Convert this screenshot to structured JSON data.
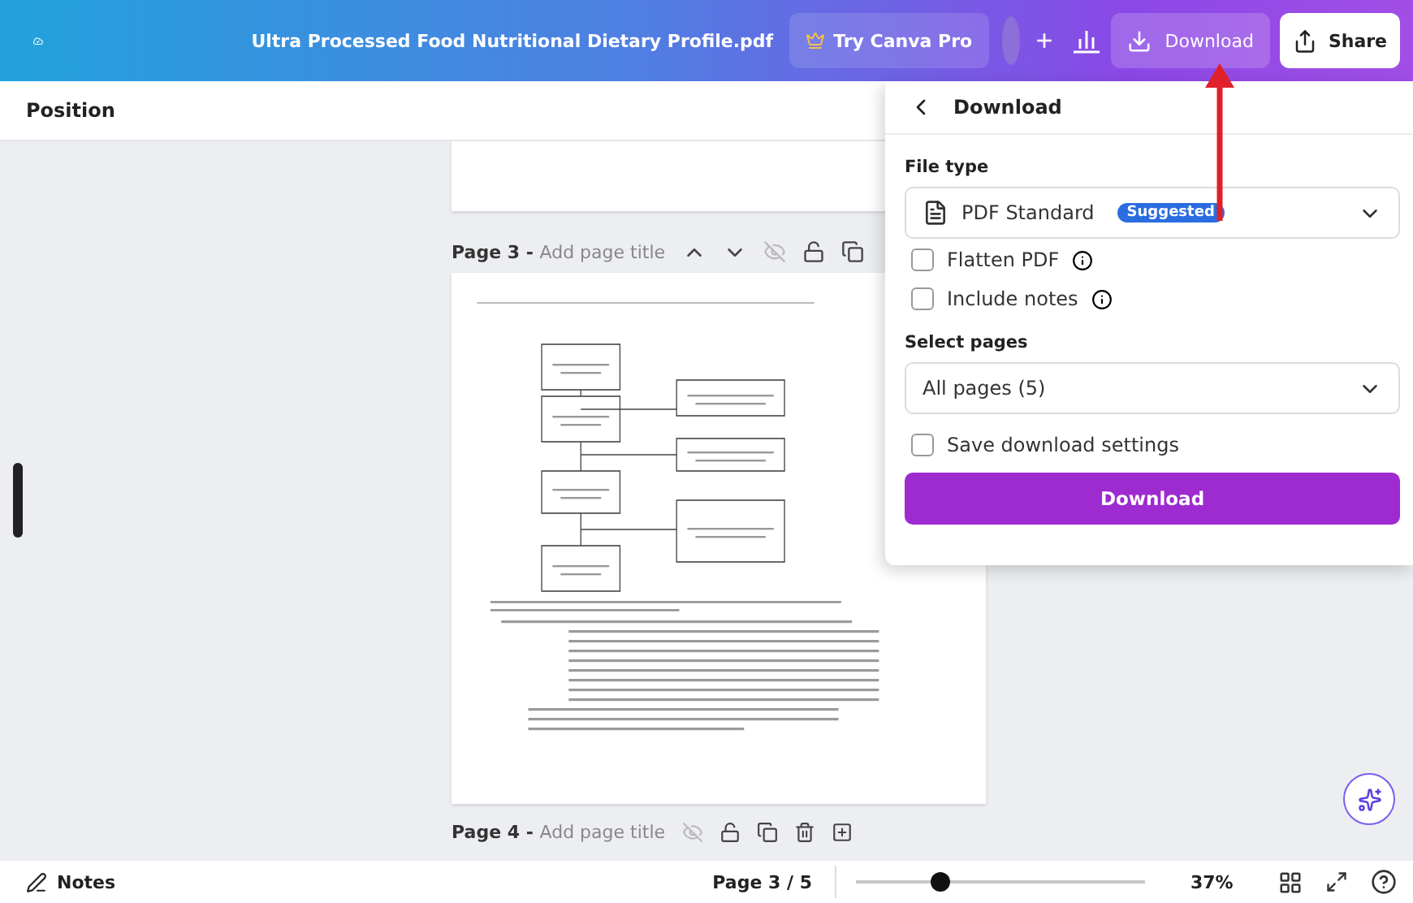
{
  "top_bar": {
    "title": "Ultra Processed Food Nutritional Dietary Profile.pdf",
    "try_pro": "Try Canva Pro",
    "add": "+",
    "download": "Download",
    "share": "Share"
  },
  "toolbar": {
    "label": "Position"
  },
  "pages": [
    {
      "label": "Page 3 -",
      "title": "Add page title"
    },
    {
      "label": "Page 4 -",
      "title": "Add page title"
    }
  ],
  "download_panel": {
    "title": "Download",
    "file_type_label": "File type",
    "file_type": "PDF Standard",
    "badge": "Suggested",
    "options": [
      {
        "label": "Flatten PDF",
        "checked": false,
        "info": true
      },
      {
        "label": "Include notes",
        "checked": false,
        "info": true
      }
    ],
    "select_pages_label": "Select pages",
    "pages_value": "All pages (5)",
    "save_settings": {
      "label": "Save download settings",
      "checked": false
    },
    "button": "Download"
  },
  "bottom_bar": {
    "notes": "Notes",
    "page_indicator": "Page 3 / 5",
    "zoom": {
      "level": 0.29,
      "reading": "37%"
    }
  }
}
